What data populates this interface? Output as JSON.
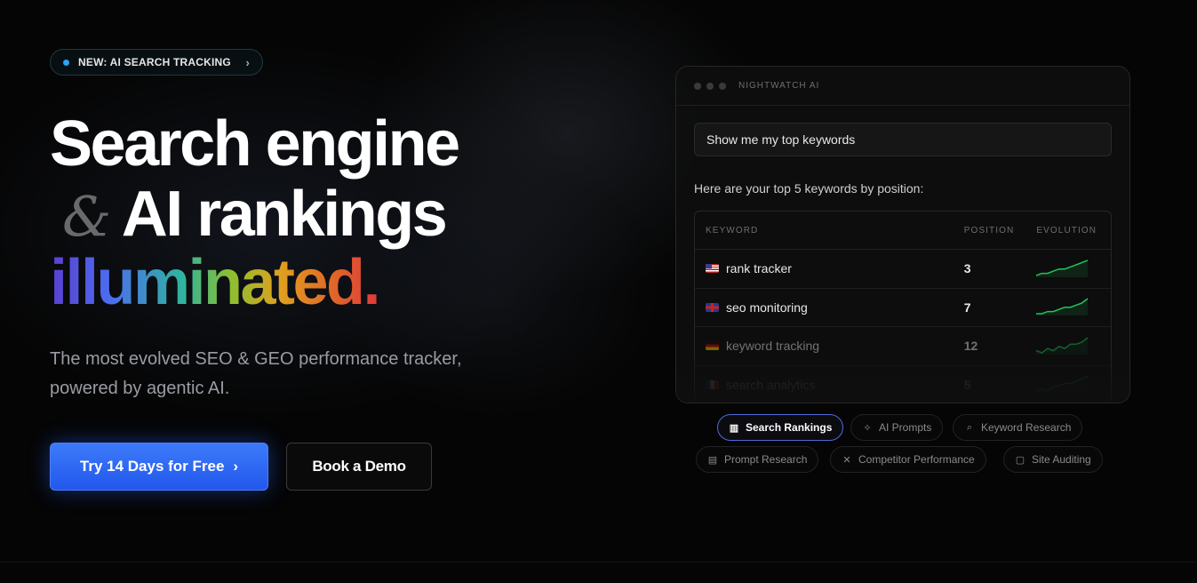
{
  "badge": {
    "label": "NEW: AI SEARCH TRACKING",
    "chevron": "›"
  },
  "headline": {
    "line1": "Search engine",
    "amp": "&",
    "line2": "AI rankings",
    "line3": "illuminated."
  },
  "subheading": "The most evolved SEO & GEO performance tracker, powered by agentic AI.",
  "cta": {
    "primary_label": "Try 14 Days for Free",
    "primary_chevron": "›",
    "secondary_label": "Book a Demo"
  },
  "panel": {
    "title": "NIGHTWATCH AI",
    "prompt": "Show me my top keywords",
    "answer": "Here are your top 5 keywords by position:",
    "columns": {
      "keyword": "KEYWORD",
      "position": "POSITION",
      "evolution": "EVOLUTION"
    },
    "rows": [
      {
        "flag": "us",
        "keyword": "rank tracker",
        "position": "3",
        "trend": [
          2,
          3,
          3,
          4,
          5,
          5,
          6,
          7,
          8,
          9
        ]
      },
      {
        "flag": "gb",
        "keyword": "seo monitoring",
        "position": "7",
        "trend": [
          2,
          2,
          3,
          3,
          4,
          5,
          5,
          6,
          7,
          9
        ]
      },
      {
        "flag": "de",
        "keyword": "keyword tracking",
        "position": "12",
        "trend": [
          3,
          2,
          4,
          3,
          5,
          4,
          6,
          6,
          7,
          9
        ]
      },
      {
        "flag": "fr",
        "keyword": "search analytics",
        "position": "5",
        "trend": [
          2,
          3,
          2,
          4,
          4,
          5,
          5,
          6,
          7,
          8
        ]
      }
    ],
    "accent_color": "#22c55e"
  },
  "feature_tabs": [
    {
      "label": "Search Rankings",
      "icon": "bar-chart-icon",
      "active": true
    },
    {
      "label": "AI Prompts",
      "icon": "sparkle-icon",
      "active": false
    },
    {
      "label": "Keyword Research",
      "icon": "search-icon",
      "active": false
    },
    {
      "label": "Prompt Research",
      "icon": "message-icon",
      "active": false
    },
    {
      "label": "Competitor Performance",
      "icon": "crossed-swords-icon",
      "active": false
    },
    {
      "label": "Site Auditing",
      "icon": "clipboard-icon",
      "active": false
    }
  ]
}
